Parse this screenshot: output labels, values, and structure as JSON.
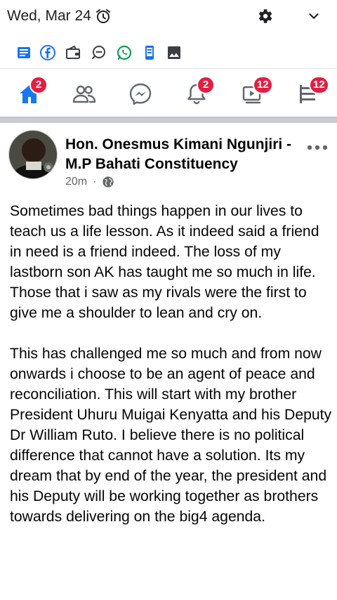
{
  "status_bar": {
    "date": "Wed, Mar 24",
    "alarm_icon": "alarm-clock-icon",
    "settings_icon": "gear-icon",
    "expand_icon": "chevron-down-icon"
  },
  "notification_icons": [
    "news-icon",
    "facebook-icon",
    "wallet-icon",
    "chat-bubble-icon",
    "whatsapp-icon",
    "phone-icon",
    "gallery-icon"
  ],
  "nav": {
    "home_badge": "2",
    "notifications_badge": "2",
    "watch_badge": "12",
    "menu_badge": "12",
    "active_color": "#1877f2",
    "icon_color": "#606770",
    "badge_color": "#e41e3f"
  },
  "post": {
    "author": "Hon. Onesmus Kimani Ngunjiri - M.P Bahati Constituency",
    "time": "20m",
    "separator": "·",
    "privacy_icon": "globe-icon",
    "body": "Sometimes bad things happen in our lives to teach us a life lesson. As it indeed said a friend in need is a friend indeed. The loss of my lastborn son AK has taught me so much in life. Those that i saw as my rivals were the first to give me a shoulder to lean and cry on.\n\nThis has challenged me so much and from now onwards i choose to be an agent of peace and reconciliation. This will start with my brother President Uhuru Muigai Kenyatta and his Deputy Dr William Ruto. I believe there is no political difference that cannot have a solution. Its my dream that by end of the year, the president and his Deputy will be working together as brothers towards delivering on the big4 agenda."
  }
}
